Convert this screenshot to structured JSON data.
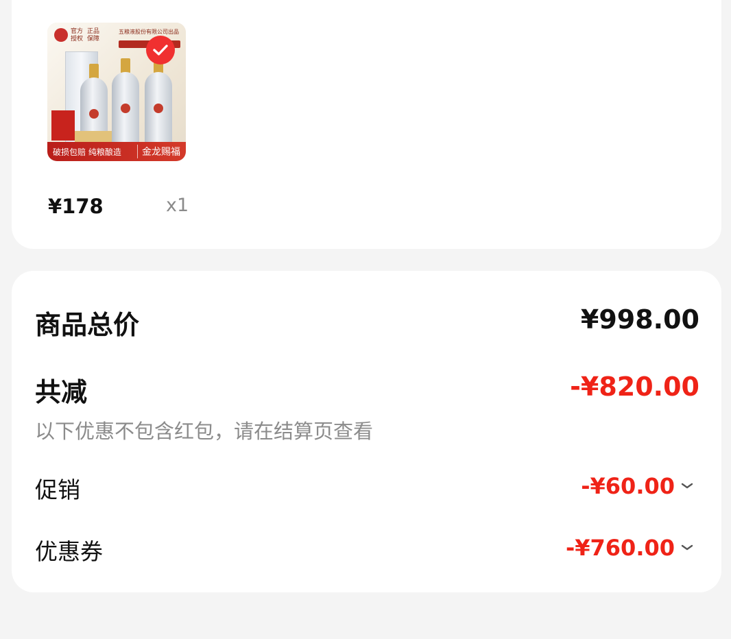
{
  "product": {
    "brand_line1": "官方",
    "brand_line2": "授权",
    "auth_line1": "正品",
    "auth_line2": "保障",
    "maker": "五粮液股份有限公司出品",
    "banner_small": "破损包赔  纯粮酿造",
    "banner_big": "金龙赐福",
    "price": "¥178",
    "quantity": "x1"
  },
  "summary": {
    "total_label": "商品总价",
    "total_value": "¥998.00",
    "discount_label": "共减",
    "discount_value": "-¥820.00",
    "discount_note": "以下优惠不包含红包，请在结算页查看",
    "promo_label": "促销",
    "promo_value": "-¥60.00",
    "coupon_label": "优惠券",
    "coupon_value": "-¥760.00"
  },
  "icons": {
    "check": "check-circle-icon",
    "chevron": "chevron-down-icon"
  },
  "colors": {
    "accent_red": "#ef2317",
    "background": "#f4f4f4",
    "card": "#ffffff"
  }
}
